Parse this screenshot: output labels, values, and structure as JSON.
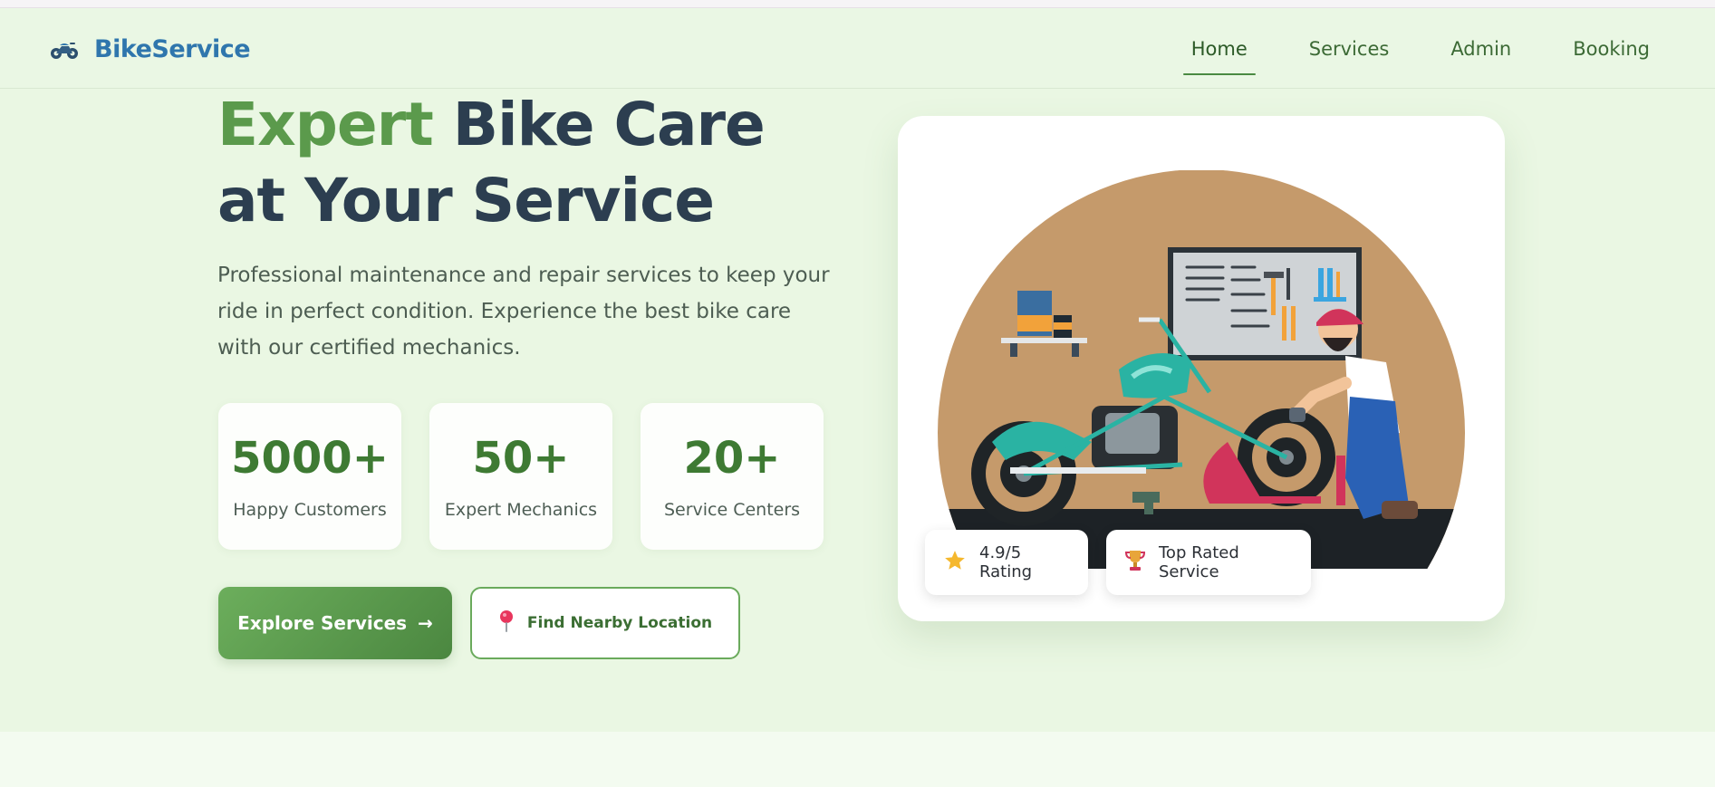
{
  "brand": {
    "name": "BikeService",
    "icon": "motorbike-icon"
  },
  "nav": {
    "items": [
      {
        "label": "Home",
        "active": true
      },
      {
        "label": "Services",
        "active": false
      },
      {
        "label": "Admin",
        "active": false
      },
      {
        "label": "Booking",
        "active": false
      }
    ]
  },
  "hero": {
    "headline_accent": "Expert",
    "headline_rest_line1": " Bike Care",
    "headline_line2": "at Your Service",
    "subtitle": "Professional maintenance and repair services to keep your ride in perfect condition. Experience the best bike care with our certified mechanics."
  },
  "stats": [
    {
      "value": "5000+",
      "label": "Happy Customers"
    },
    {
      "value": "50+",
      "label": "Expert Mechanics"
    },
    {
      "value": "20+",
      "label": "Service Centers"
    }
  ],
  "buttons": {
    "explore_label": "Explore Services",
    "explore_arrow": "→",
    "location_label": "Find Nearby Location",
    "location_icon": "pin-icon"
  },
  "badges": {
    "rating_label": "4.9/5 Rating",
    "rating_icon": "star-icon",
    "top_label": "Top Rated Service",
    "top_icon": "trophy-icon"
  },
  "colors": {
    "brand_blue": "#2f76ad",
    "accent_green": "#5b9a4c",
    "heading_navy": "#2c3e50",
    "hero_bg": "#eaf7e3"
  }
}
